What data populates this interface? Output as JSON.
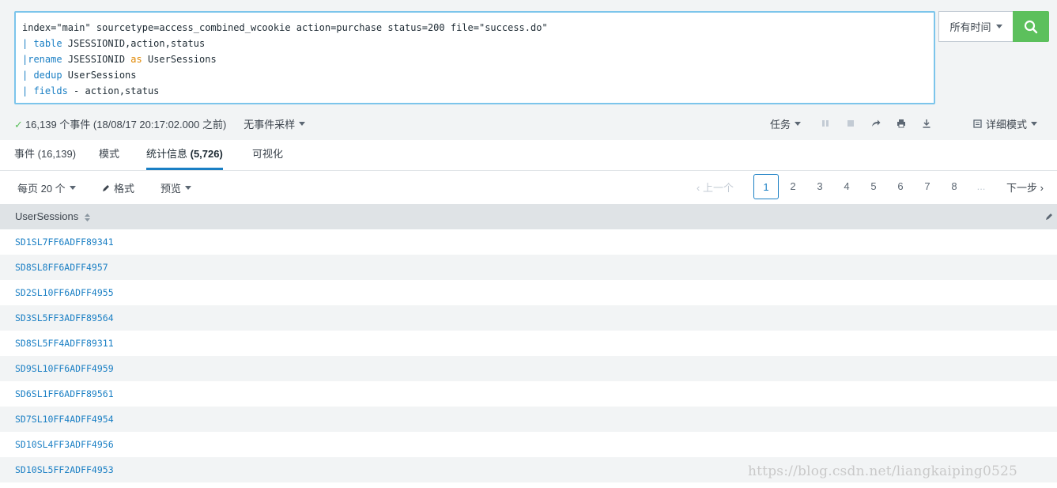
{
  "search": {
    "lines": [
      {
        "pre": "",
        "kw": "",
        "kw2": "",
        "text": "index=\"main\" sourcetype=access_combined_wcookie action=purchase status=200 file=\"success.do\""
      },
      {
        "pre": "| ",
        "kw": "table",
        "text": " JSESSIONID,action,status"
      },
      {
        "pre": "|",
        "kw": "rename",
        "text_a": " JSESSIONID ",
        "kw2": "as",
        "text_b": " UserSessions"
      },
      {
        "pre": "| ",
        "kw": "dedup",
        "text": " UserSessions"
      },
      {
        "pre": "| ",
        "kw": "fields",
        "text": " - action,status"
      }
    ],
    "time_picker": "所有时间"
  },
  "status": {
    "check": "✓",
    "summary": "16,139 个事件 (18/08/17 20:17:02.000 之前)",
    "sampling": "无事件采样",
    "job": "任务",
    "mode": "详细模式"
  },
  "tabs": [
    {
      "label": "事件 (16,139)"
    },
    {
      "label": "模式"
    },
    {
      "label_main": "统计信息 ",
      "label_count": "(5,726)"
    },
    {
      "label": "可视化"
    }
  ],
  "toolbar": {
    "per_page": "每页 20 个",
    "format": "格式",
    "preview": "预览"
  },
  "pager": {
    "prev": "上一个",
    "pages": [
      "1",
      "2",
      "3",
      "4",
      "5",
      "6",
      "7",
      "8",
      "..."
    ],
    "current": "1",
    "next": "下一步"
  },
  "table": {
    "column": "UserSessions",
    "rows": [
      "SD1SL7FF6ADFF89341",
      "SD8SL8FF6ADFF4957",
      "SD2SL10FF6ADFF4955",
      "SD3SL5FF3ADFF89564",
      "SD8SL5FF4ADFF89311",
      "SD9SL10FF6ADFF4959",
      "SD6SL1FF6ADFF89561",
      "SD7SL10FF4ADFF4954",
      "SD10SL4FF3ADFF4956",
      "SD10SL5FF2ADFF4953"
    ]
  },
  "watermark": "https://blog.csdn.net/liangkaiping0525",
  "colors": {
    "accent": "#1a7fc4",
    "search_green": "#5cc05c",
    "keyword_orange": "#e08700"
  }
}
